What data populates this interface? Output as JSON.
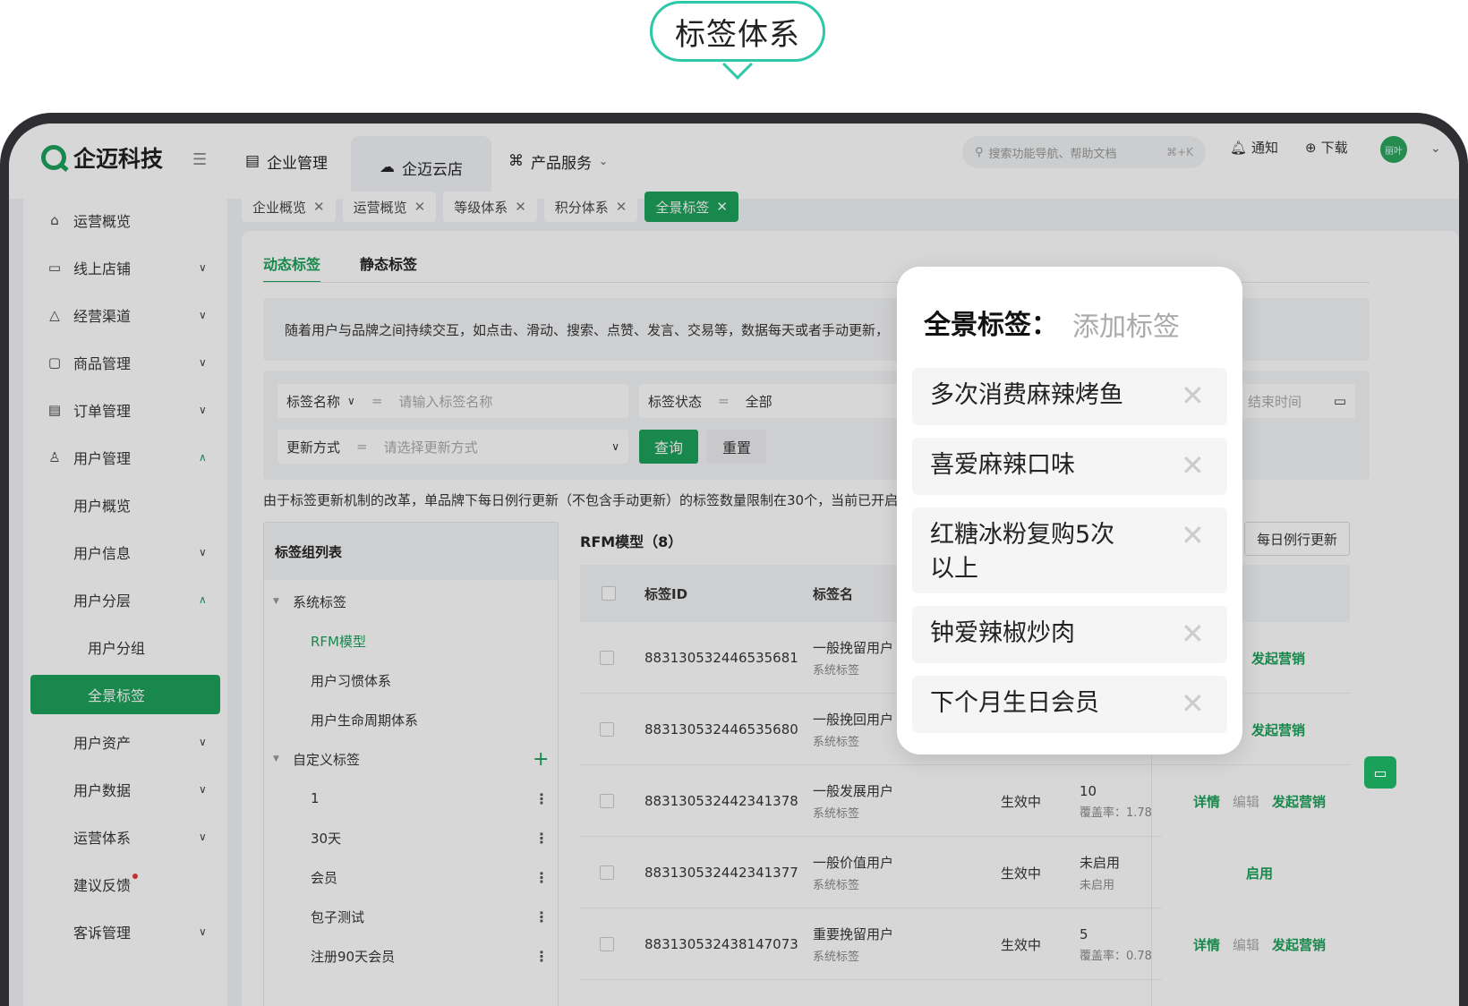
{
  "bubble_title": "标签体系",
  "app": {
    "brand": "企迈科技",
    "nav": [
      "企业管理",
      "企迈云店",
      "产品服务"
    ],
    "search_placeholder": "搜索功能导航、帮助文档",
    "search_shortcut": "⌘+K",
    "notify": "通知",
    "download": "下载",
    "avatar_text": "丽叶"
  },
  "sidebar": [
    "运营概览",
    "线上店铺",
    "经营渠道",
    "商品管理",
    "订单管理",
    "用户管理",
    "用户概览",
    "用户信息",
    "用户分层",
    "用户分组",
    "全景标签",
    "用户资产",
    "用户数据",
    "运营体系",
    "建议反馈",
    "客诉管理"
  ],
  "page_tabs": [
    "企业概览",
    "运营概览",
    "等级体系",
    "积分体系",
    "全景标签"
  ],
  "sub_tabs": [
    "动态标签",
    "静态标签"
  ],
  "notice": "随着用户与品牌之间持续交互，如点击、滑动、搜索、点赞、发言、交易等，数据每天或者手动更新，",
  "filters": {
    "name_label": "标签名称",
    "name_placeholder": "请输入标签名称",
    "status_label": "标签状态",
    "status_value": "全部",
    "update_label": "更新方式",
    "update_placeholder": "请选择更新方式",
    "end_time": "结束时间",
    "query": "查询",
    "reset": "重置",
    "eq": "="
  },
  "limit_text": "由于标签更新机制的改革，单品牌下每日例行更新（不包含手动更新）的标签数量限制在30个，当前已开启",
  "group_list": {
    "title": "标签组列表",
    "system": "系统标签",
    "system_items": [
      "RFM模型",
      "用户习惯体系",
      "用户生命周期体系"
    ],
    "custom": "自定义标签",
    "custom_items": [
      "1",
      "30天",
      "会员",
      "包子测试",
      "注册90天会员"
    ]
  },
  "table": {
    "title": "RFM模型（8）",
    "daily_button": "每日例行更新",
    "col_id": "标签ID",
    "col_name": "标签名",
    "rows": [
      {
        "id": "883130532446535681",
        "name": "一般挽留用户",
        "type": "系统标签",
        "status": "",
        "count": "",
        "rate": "",
        "ops": [
          "发起营销"
        ]
      },
      {
        "id": "883130532446535680",
        "name": "一般挽回用户",
        "type": "系统标签",
        "status": "",
        "count": "",
        "rate": "",
        "ops": [
          "发起营销"
        ]
      },
      {
        "id": "883130532442341378",
        "name": "一般发展用户",
        "type": "系统标签",
        "status": "生效中",
        "count": "10",
        "rate": "覆盖率：1.78",
        "ops": [
          "详情",
          "编辑",
          "发起营销"
        ]
      },
      {
        "id": "883130532442341377",
        "name": "一般价值用户",
        "type": "系统标签",
        "status": "生效中",
        "count": "未启用",
        "rate": "未启用",
        "ops": [
          "启用"
        ]
      },
      {
        "id": "883130532438147073",
        "name": "重要挽留用户",
        "type": "系统标签",
        "status": "生效中",
        "count": "5",
        "rate": "覆盖率：0.78",
        "ops": [
          "详情",
          "编辑",
          "发起营销"
        ]
      }
    ]
  },
  "popup": {
    "title": "全景标签：",
    "add": "添加标签",
    "tags": [
      "多次消费麻辣烤鱼",
      "喜爱麻辣口味",
      "红糖冰粉复购5次以上",
      "钟爱辣椒炒肉",
      "下个月生日会员"
    ]
  },
  "colors": {
    "accent": "#1ba05a",
    "bubble_border": "#2cc8a8"
  }
}
